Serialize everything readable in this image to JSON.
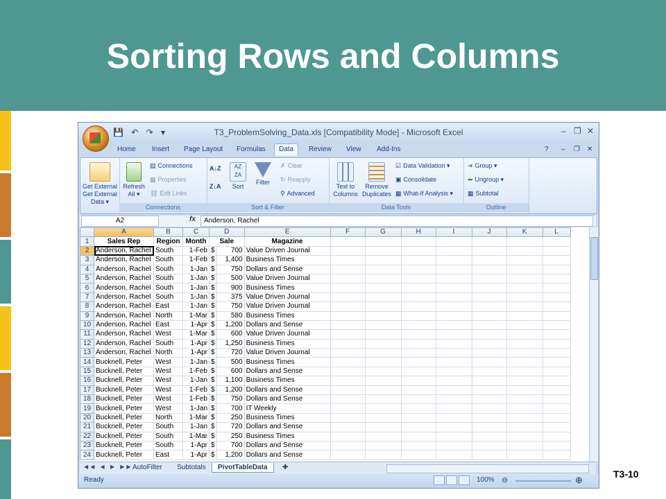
{
  "slide": {
    "title": "Sorting Rows and Columns",
    "number": "T3-10",
    "colors": {
      "banner": "#4f9891",
      "stripe_gold": "#f5c21b",
      "stripe_orange": "#c97a2a",
      "stripe_teal": "#4f9891"
    }
  },
  "window": {
    "title": "T3_ProblemSolving_Data.xls  [Compatibility Mode] - Microsoft Excel",
    "controls": {
      "minimize": "–",
      "restore": "❐",
      "close": "✕"
    }
  },
  "ribbon": {
    "tabs": [
      "Home",
      "Insert",
      "Page Layout",
      "Formulas",
      "Data",
      "Review",
      "View",
      "Add-Ins"
    ],
    "active_tab": "Data",
    "groups": {
      "get_external": {
        "label": "Get External Data ▾"
      },
      "connections": {
        "label": "Connections",
        "refresh": "Refresh All ▾",
        "connections": "Connections",
        "properties": "Properties",
        "edit_links": "Edit Links"
      },
      "sort_filter": {
        "label": "Sort & Filter",
        "sort": "Sort",
        "filter": "Filter",
        "clear": "Clear",
        "reapply": "Reapply",
        "advanced": "Advanced"
      },
      "data_tools": {
        "label": "Data Tools",
        "text_to_columns": "Text to Columns",
        "remove_duplicates": "Remove Duplicates",
        "data_validation": "Data Validation ▾",
        "consolidate": "Consolidate",
        "what_if": "What-If Analysis ▾"
      },
      "outline": {
        "label": "Outline",
        "group": "Group ▾",
        "ungroup": "Ungroup ▾",
        "subtotal": "Subtotal"
      }
    }
  },
  "formula_bar": {
    "name_box": "A2",
    "fx": "fx",
    "formula": "Anderson, Rachel"
  },
  "sheet": {
    "columns": [
      "A",
      "B",
      "C",
      "D",
      "E",
      "F",
      "G",
      "H",
      "I",
      "J",
      "K",
      "L"
    ],
    "header_row": {
      "row": "1",
      "sales_rep": "Sales Rep",
      "region": "Region",
      "month": "Month",
      "sale": "Sale",
      "magazine": "Magazine"
    },
    "rows": [
      {
        "row": "2",
        "rep": "Anderson, Rachel",
        "region": "South",
        "month": "1-Feb",
        "cur": "$",
        "sale": "700",
        "magazine": "Value Driven Journal"
      },
      {
        "row": "3",
        "rep": "Anderson, Rachel",
        "region": "South",
        "month": "1-Feb",
        "cur": "$",
        "sale": "1,400",
        "magazine": "Business Times"
      },
      {
        "row": "4",
        "rep": "Anderson, Rachel",
        "region": "South",
        "month": "1-Jan",
        "cur": "$",
        "sale": "750",
        "magazine": "Dollars and Sense"
      },
      {
        "row": "5",
        "rep": "Anderson, Rachel",
        "region": "South",
        "month": "1-Jan",
        "cur": "$",
        "sale": "500",
        "magazine": "Value Driven Journal"
      },
      {
        "row": "6",
        "rep": "Anderson, Rachel",
        "region": "South",
        "month": "1-Jan",
        "cur": "$",
        "sale": "900",
        "magazine": "Business Times"
      },
      {
        "row": "7",
        "rep": "Anderson, Rachel",
        "region": "South",
        "month": "1-Jan",
        "cur": "$",
        "sale": "375",
        "magazine": "Value Driven Journal"
      },
      {
        "row": "8",
        "rep": "Anderson, Rachel",
        "region": "East",
        "month": "1-Jan",
        "cur": "$",
        "sale": "750",
        "magazine": "Value Driven Journal"
      },
      {
        "row": "9",
        "rep": "Anderson, Rachel",
        "region": "North",
        "month": "1-Mar",
        "cur": "$",
        "sale": "580",
        "magazine": "Business Times"
      },
      {
        "row": "10",
        "rep": "Anderson, Rachel",
        "region": "East",
        "month": "1-Apr",
        "cur": "$",
        "sale": "1,200",
        "magazine": "Dollars and Sense"
      },
      {
        "row": "11",
        "rep": "Anderson, Rachel",
        "region": "West",
        "month": "1-Mar",
        "cur": "$",
        "sale": "600",
        "magazine": "Value Driven Journal"
      },
      {
        "row": "12",
        "rep": "Anderson, Rachel",
        "region": "South",
        "month": "1-Apr",
        "cur": "$",
        "sale": "1,250",
        "magazine": "Business Times"
      },
      {
        "row": "13",
        "rep": "Anderson, Rachel",
        "region": "North",
        "month": "1-Apr",
        "cur": "$",
        "sale": "720",
        "magazine": "Value Driven Journal"
      },
      {
        "row": "14",
        "rep": "Bucknell, Peter",
        "region": "West",
        "month": "1-Jan",
        "cur": "$",
        "sale": "500",
        "magazine": "Business Times"
      },
      {
        "row": "15",
        "rep": "Bucknell, Peter",
        "region": "West",
        "month": "1-Feb",
        "cur": "$",
        "sale": "600",
        "magazine": "Dollars and Sense"
      },
      {
        "row": "16",
        "rep": "Bucknell, Peter",
        "region": "West",
        "month": "1-Jan",
        "cur": "$",
        "sale": "1,100",
        "magazine": "Business Times"
      },
      {
        "row": "17",
        "rep": "Bucknell, Peter",
        "region": "West",
        "month": "1-Feb",
        "cur": "$",
        "sale": "1,200",
        "magazine": "Dollars and Sense"
      },
      {
        "row": "18",
        "rep": "Bucknell, Peter",
        "region": "West",
        "month": "1-Feb",
        "cur": "$",
        "sale": "750",
        "magazine": "Dollars and Sense"
      },
      {
        "row": "19",
        "rep": "Bucknell, Peter",
        "region": "West",
        "month": "1-Jan",
        "cur": "$",
        "sale": "700",
        "magazine": "IT Weekly"
      },
      {
        "row": "20",
        "rep": "Bucknell, Peter",
        "region": "North",
        "month": "1-Mar",
        "cur": "$",
        "sale": "250",
        "magazine": "Business Times"
      },
      {
        "row": "21",
        "rep": "Bucknell, Peter",
        "region": "South",
        "month": "1-Jan",
        "cur": "$",
        "sale": "720",
        "magazine": "Dollars and Sense"
      },
      {
        "row": "22",
        "rep": "Bucknell, Peter",
        "region": "South",
        "month": "1-Mar",
        "cur": "$",
        "sale": "250",
        "magazine": "Business Times"
      },
      {
        "row": "23",
        "rep": "Bucknell, Peter",
        "region": "South",
        "month": "1-Apr",
        "cur": "$",
        "sale": "700",
        "magazine": "Dollars and Sense"
      },
      {
        "row": "24",
        "rep": "Bucknell, Peter",
        "region": "East",
        "month": "1-Apr",
        "cur": "$",
        "sale": "1,200",
        "magazine": "Dollars and Sense"
      }
    ],
    "tabs": [
      "AutoFilter",
      "Subtotals",
      "PivotTableData"
    ],
    "active_sheet": "PivotTableData"
  },
  "status": {
    "ready": "Ready",
    "zoom": "100%"
  }
}
